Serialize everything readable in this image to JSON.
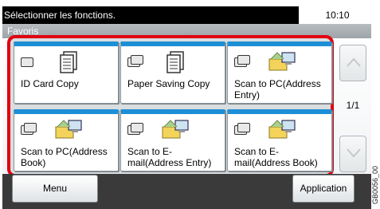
{
  "status": {
    "message": "Sélectionner les fonctions.",
    "time": "10:10"
  },
  "header": {
    "title": "Favoris"
  },
  "favorites": [
    {
      "label": "ID Card Copy",
      "icon": "copy-icon"
    },
    {
      "label": "Paper Saving Copy",
      "icon": "copy-icon"
    },
    {
      "label": "Scan to PC(Address Entry)",
      "icon": "scan-to-pc-icon"
    },
    {
      "label": "Scan to PC(Address Book)",
      "icon": "scan-to-pc-icon"
    },
    {
      "label": "Scan to E-mail(Address Entry)",
      "icon": "scan-to-email-icon"
    },
    {
      "label": "Scan to E-mail(Address Book)",
      "icon": "scan-to-email-icon"
    }
  ],
  "pagination": {
    "page": "1/1"
  },
  "footer": {
    "menu_label": "Menu",
    "application_label": "Application"
  },
  "side_code": "GB0056_00",
  "colors": {
    "accent_blue": "#1d8fd6",
    "highlight_red": "#e00010"
  }
}
